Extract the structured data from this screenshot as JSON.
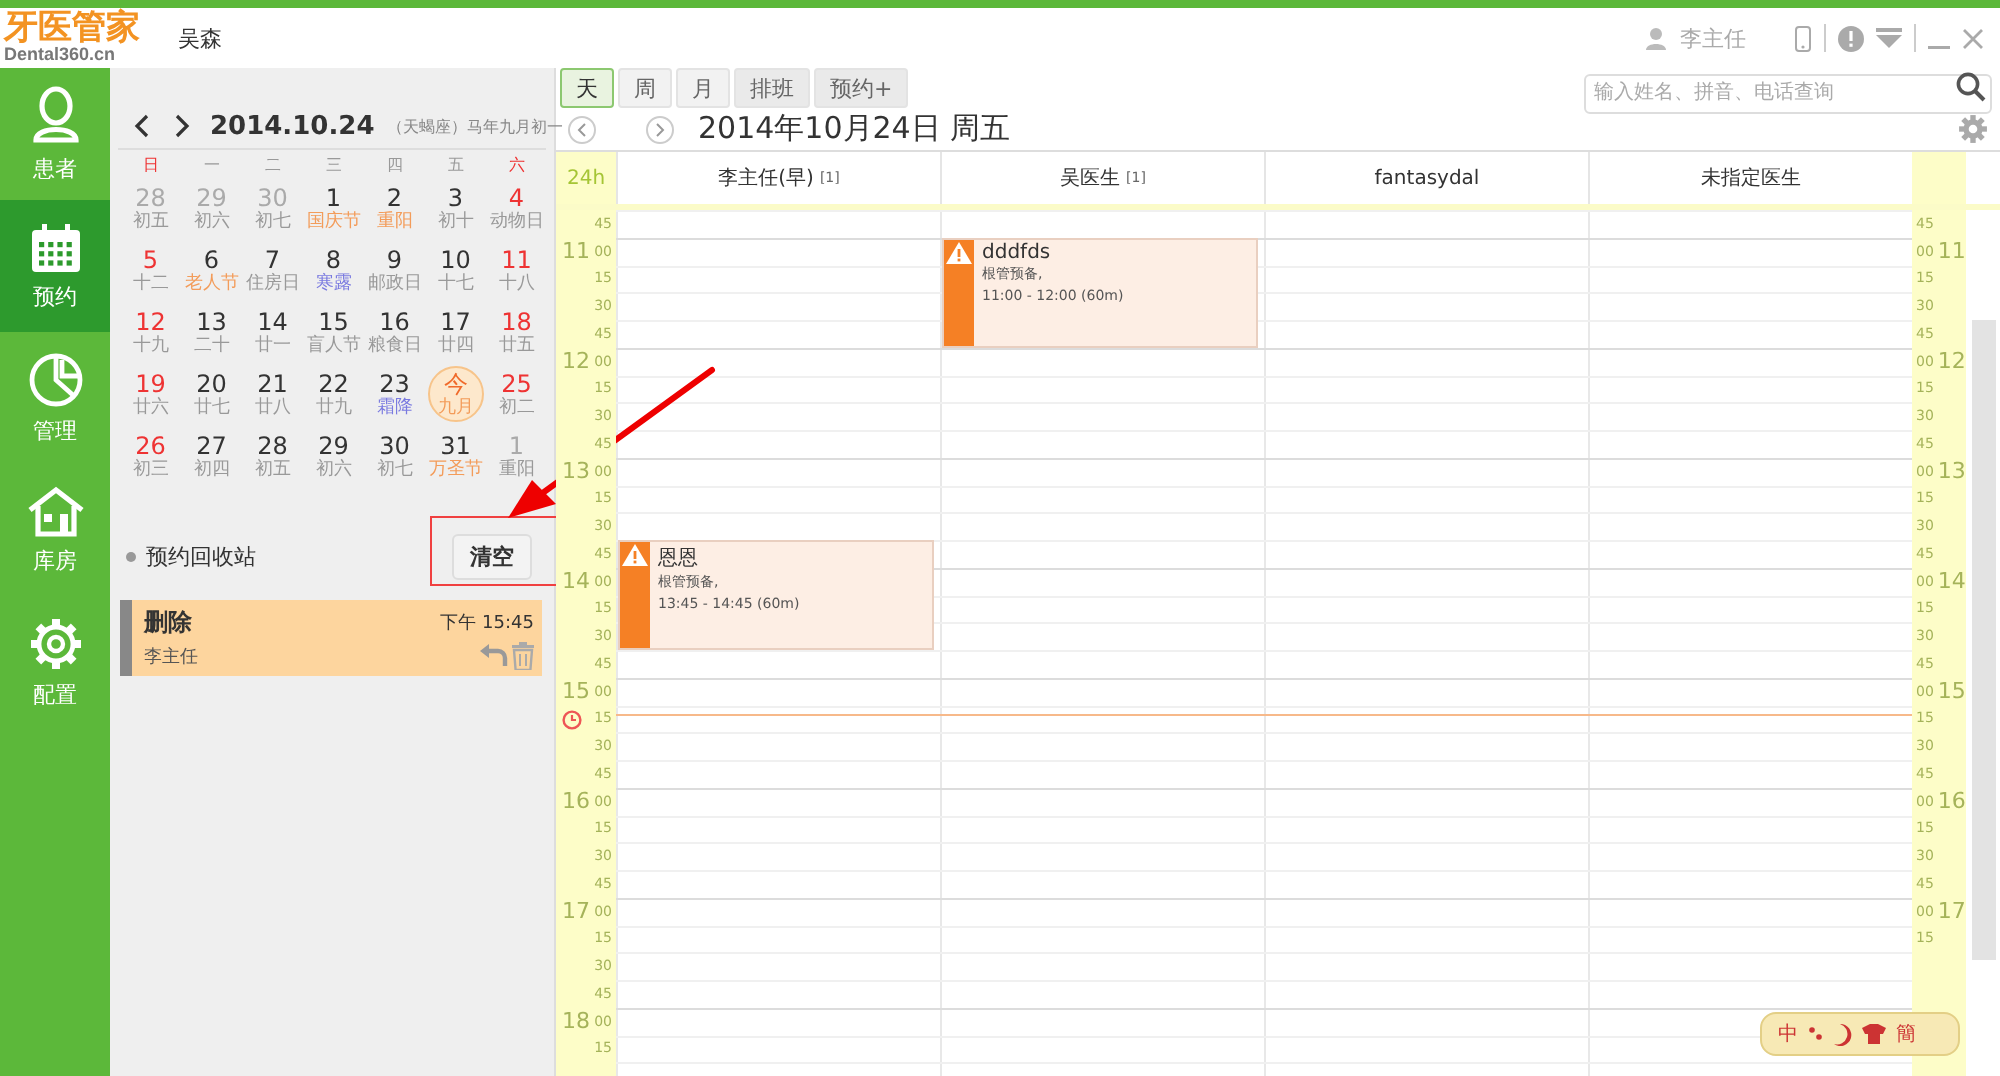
{
  "app": {
    "logo": "牙医管家",
    "logo_sub": "Dental360.cn",
    "clinic": "吴森",
    "user": "李主任"
  },
  "sidebar": {
    "items": [
      {
        "label": "患者",
        "selected": false
      },
      {
        "label": "预约",
        "selected": true
      },
      {
        "label": "管理",
        "selected": false
      },
      {
        "label": "库房",
        "selected": false
      },
      {
        "label": "配置",
        "selected": false
      }
    ]
  },
  "mini_calendar": {
    "title": "2014.10.24",
    "subtitle": "（天蝎座）马年九月初一",
    "weekdays": [
      {
        "label": "日",
        "weekend": true
      },
      {
        "label": "一",
        "weekend": false
      },
      {
        "label": "二",
        "weekend": false
      },
      {
        "label": "三",
        "weekend": false
      },
      {
        "label": "四",
        "weekend": false
      },
      {
        "label": "五",
        "weekend": false
      },
      {
        "label": "六",
        "weekend": true
      }
    ],
    "days": [
      {
        "day": "28",
        "lunar": "初五",
        "other_month": true,
        "weekend": false,
        "today": false,
        "color": "#999999"
      },
      {
        "day": "29",
        "lunar": "初六",
        "other_month": true,
        "weekend": false,
        "today": false,
        "color": "#999999"
      },
      {
        "day": "30",
        "lunar": "初七",
        "other_month": true,
        "weekend": false,
        "today": false,
        "color": "#999999"
      },
      {
        "day": "1",
        "lunar": "国庆节",
        "other_month": false,
        "weekend": false,
        "today": false,
        "color": "#f39c5a"
      },
      {
        "day": "2",
        "lunar": "重阳",
        "other_month": false,
        "weekend": false,
        "today": false,
        "color": "#f39c5a"
      },
      {
        "day": "3",
        "lunar": "初十",
        "other_month": false,
        "weekend": false,
        "today": false,
        "color": "#999999"
      },
      {
        "day": "4",
        "lunar": "动物日",
        "other_month": false,
        "weekend": true,
        "today": false,
        "color": "#999999"
      },
      {
        "day": "5",
        "lunar": "十二",
        "other_month": false,
        "weekend": true,
        "today": false,
        "color": "#999999"
      },
      {
        "day": "6",
        "lunar": "老人节",
        "other_month": false,
        "weekend": false,
        "today": false,
        "color": "#f39c5a"
      },
      {
        "day": "7",
        "lunar": "住房日",
        "other_month": false,
        "weekend": false,
        "today": false,
        "color": "#999999"
      },
      {
        "day": "8",
        "lunar": "寒露",
        "other_month": false,
        "weekend": false,
        "today": false,
        "color": "#7a7ae0"
      },
      {
        "day": "9",
        "lunar": "邮政日",
        "other_month": false,
        "weekend": false,
        "today": false,
        "color": "#999999"
      },
      {
        "day": "10",
        "lunar": "十七",
        "other_month": false,
        "weekend": false,
        "today": false,
        "color": "#999999"
      },
      {
        "day": "11",
        "lunar": "十八",
        "other_month": false,
        "weekend": true,
        "today": false,
        "color": "#999999"
      },
      {
        "day": "12",
        "lunar": "十九",
        "other_month": false,
        "weekend": true,
        "today": false,
        "color": "#999999"
      },
      {
        "day": "13",
        "lunar": "二十",
        "other_month": false,
        "weekend": false,
        "today": false,
        "color": "#999999"
      },
      {
        "day": "14",
        "lunar": "廿一",
        "other_month": false,
        "weekend": false,
        "today": false,
        "color": "#999999"
      },
      {
        "day": "15",
        "lunar": "盲人节",
        "other_month": false,
        "weekend": false,
        "today": false,
        "color": "#999999"
      },
      {
        "day": "16",
        "lunar": "粮食日",
        "other_month": false,
        "weekend": false,
        "today": false,
        "color": "#999999"
      },
      {
        "day": "17",
        "lunar": "廿四",
        "other_month": false,
        "weekend": false,
        "today": false,
        "color": "#999999"
      },
      {
        "day": "18",
        "lunar": "廿五",
        "other_month": false,
        "weekend": true,
        "today": false,
        "color": "#999999"
      },
      {
        "day": "19",
        "lunar": "廿六",
        "other_month": false,
        "weekend": true,
        "today": false,
        "color": "#999999"
      },
      {
        "day": "20",
        "lunar": "廿七",
        "other_month": false,
        "weekend": false,
        "today": false,
        "color": "#999999"
      },
      {
        "day": "21",
        "lunar": "廿八",
        "other_month": false,
        "weekend": false,
        "today": false,
        "color": "#999999"
      },
      {
        "day": "22",
        "lunar": "廿九",
        "other_month": false,
        "weekend": false,
        "today": false,
        "color": "#999999"
      },
      {
        "day": "23",
        "lunar": "霜降",
        "other_month": false,
        "weekend": false,
        "today": false,
        "color": "#7a7ae0"
      },
      {
        "day": "今",
        "lunar": "九月",
        "other_month": false,
        "weekend": false,
        "today": true,
        "color": "#f39c5a"
      },
      {
        "day": "25",
        "lunar": "初二",
        "other_month": false,
        "weekend": true,
        "today": false,
        "color": "#999999"
      },
      {
        "day": "26",
        "lunar": "初三",
        "other_month": false,
        "weekend": true,
        "today": false,
        "color": "#999999"
      },
      {
        "day": "27",
        "lunar": "初四",
        "other_month": false,
        "weekend": false,
        "today": false,
        "color": "#999999"
      },
      {
        "day": "28",
        "lunar": "初五",
        "other_month": false,
        "weekend": false,
        "today": false,
        "color": "#999999"
      },
      {
        "day": "29",
        "lunar": "初六",
        "other_month": false,
        "weekend": false,
        "today": false,
        "color": "#999999"
      },
      {
        "day": "30",
        "lunar": "初七",
        "other_month": false,
        "weekend": false,
        "today": false,
        "color": "#999999"
      },
      {
        "day": "31",
        "lunar": "万圣节",
        "other_month": false,
        "weekend": false,
        "today": false,
        "color": "#f39c5a"
      },
      {
        "day": "1",
        "lunar": "重阳",
        "other_month": true,
        "weekend": false,
        "today": false,
        "color": "#999999"
      }
    ]
  },
  "recycle_bin": {
    "title": "预约回收站",
    "clear_button": "清空",
    "items": [
      {
        "title": "删除",
        "time": "下午 15:45",
        "doctor": "李主任"
      }
    ]
  },
  "toolbar": {
    "views": [
      {
        "label": "天",
        "selected": true
      },
      {
        "label": "周",
        "selected": false
      },
      {
        "label": "月",
        "selected": false
      }
    ],
    "buttons": [
      "排班",
      "预约+"
    ],
    "search": {
      "placeholder": "输入姓名、拼音、电话查询"
    }
  },
  "date_title": "2014年10月24日 周五",
  "schedule": {
    "corner": "24h",
    "columns": [
      {
        "name": "李主任(早)",
        "count": "[1]",
        "appointments": [
          {
            "patient": "恩恩",
            "note": "根管预备,",
            "time": "13:45 - 14:45 (60m)"
          }
        ]
      },
      {
        "name": "吴医生",
        "count": "[1]",
        "appointments": [
          {
            "patient": "dddfds",
            "note": "根管预备,",
            "time": "11:00 - 12:00 (60m)"
          }
        ]
      },
      {
        "name": "fantasydal"
      },
      {
        "name": "未指定医生"
      }
    ],
    "time_rows": [
      {
        "minute": "45",
        "right_minute": "45",
        "current": false
      },
      {
        "hour": "11",
        "minute": "00",
        "right_hour": "11",
        "right_minute": "00",
        "current": false
      },
      {
        "minute": "15",
        "right_minute": "15",
        "current": false
      },
      {
        "minute": "30",
        "right_minute": "30",
        "current": false
      },
      {
        "minute": "45",
        "right_minute": "45",
        "current": false
      },
      {
        "hour": "12",
        "minute": "00",
        "right_hour": "12",
        "right_minute": "00",
        "current": false
      },
      {
        "minute": "15",
        "right_minute": "15",
        "current": false
      },
      {
        "minute": "30",
        "right_minute": "30",
        "current": false
      },
      {
        "minute": "45",
        "right_minute": "45",
        "current": false
      },
      {
        "hour": "13",
        "minute": "00",
        "right_hour": "13",
        "right_minute": "00",
        "current": false
      },
      {
        "minute": "15",
        "right_minute": "15",
        "current": false
      },
      {
        "minute": "30",
        "right_minute": "30",
        "current": false
      },
      {
        "minute": "45",
        "right_minute": "45",
        "current": false
      },
      {
        "hour": "14",
        "minute": "00",
        "right_hour": "14",
        "right_minute": "00",
        "current": false
      },
      {
        "minute": "15",
        "right_minute": "15",
        "current": false
      },
      {
        "minute": "30",
        "right_minute": "30",
        "current": false
      },
      {
        "minute": "45",
        "right_minute": "45",
        "current": false
      },
      {
        "hour": "15",
        "minute": "00",
        "right_hour": "15",
        "right_minute": "00",
        "current": false
      },
      {
        "minute": "15",
        "right_minute": "15",
        "current": true
      },
      {
        "minute": "30",
        "right_minute": "30",
        "current": false
      },
      {
        "minute": "45",
        "right_minute": "45",
        "current": false
      },
      {
        "hour": "16",
        "minute": "00",
        "right_hour": "16",
        "right_minute": "00",
        "current": false
      },
      {
        "minute": "15",
        "right_minute": "15",
        "current": false
      },
      {
        "minute": "30",
        "right_minute": "30",
        "current": false
      },
      {
        "minute": "45",
        "right_minute": "45",
        "current": false
      },
      {
        "hour": "17",
        "minute": "00",
        "right_hour": "17",
        "right_minute": "00",
        "current": false
      },
      {
        "minute": "15",
        "right_minute": "15",
        "current": false
      },
      {
        "minute": "30",
        "current": false
      },
      {
        "minute": "45",
        "current": false
      },
      {
        "hour": "18",
        "minute": "00",
        "current": false
      },
      {
        "minute": "15",
        "current": false
      }
    ]
  },
  "ime_bar": {
    "mode": "中",
    "script": "簡"
  }
}
